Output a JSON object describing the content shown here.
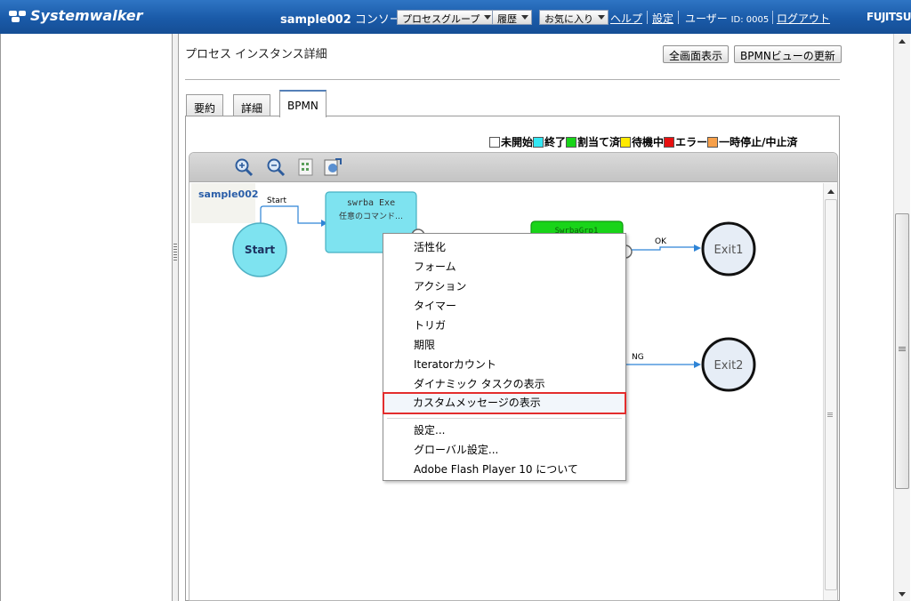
{
  "header": {
    "logo_text": "Systemwalker",
    "console_name": "sample002",
    "console_suffix": "コンソール",
    "menus": [
      {
        "label": "プロセスグループ"
      },
      {
        "label": "履歴"
      },
      {
        "label": "お気に入り"
      }
    ],
    "help": "ヘルプ",
    "settings": "設定",
    "user_prefix": "ユーザー",
    "user_id_label": "ID: 0005",
    "logout": "ログアウト",
    "vendor": "FUJITSU"
  },
  "page": {
    "title": "プロセス インスタンス詳細",
    "fullscreen_button": "全画面表示",
    "refresh_button": "BPMNビューの更新"
  },
  "tabs": [
    {
      "label": "要約",
      "active": false
    },
    {
      "label": "詳細",
      "active": false
    },
    {
      "label": "BPMN",
      "active": true
    }
  ],
  "legend": [
    {
      "label": "未開始",
      "color": "#ffffff"
    },
    {
      "label": "終了",
      "color": "#33e7f3"
    },
    {
      "label": "割当て済",
      "color": "#19d419"
    },
    {
      "label": "待機中",
      "color": "#ffea00"
    },
    {
      "label": "エラー",
      "color": "#e81010"
    },
    {
      "label": "一時停止/中止済",
      "color": "#f7a04a"
    }
  ],
  "toolbar": {
    "icons": [
      "zoom-in-icon",
      "zoom-out-icon",
      "fit-page-icon",
      "export-icon"
    ]
  },
  "diagram": {
    "process_label": "sample002",
    "start_event": "Start",
    "start_flow_label": "Start",
    "task1_title": "swrba Exe",
    "task1_sub": "任意のコマンド…",
    "task2_title": "SwrbaGrp1",
    "ok_flow_label": "OK",
    "ng_flow_label": "NG",
    "exit1": "Exit1",
    "exit2": "Exit2",
    "colors": {
      "finished": "#7ee3f0",
      "assigned": "#19d419",
      "not_started": "#e6edf6"
    }
  },
  "context_menu": {
    "items": [
      {
        "label": "活性化"
      },
      {
        "label": "フォーム"
      },
      {
        "label": "アクション"
      },
      {
        "label": "タイマー"
      },
      {
        "label": "トリガ"
      },
      {
        "label": "期限"
      },
      {
        "label": "Iteratorカウント"
      },
      {
        "label": "ダイナミック タスクの表示"
      },
      {
        "label": "カスタムメッセージの表示",
        "highlighted": true
      }
    ],
    "items2": [
      {
        "label": "設定..."
      },
      {
        "label": "グローバル設定..."
      },
      {
        "label": "Adobe Flash Player 10  について"
      }
    ]
  }
}
